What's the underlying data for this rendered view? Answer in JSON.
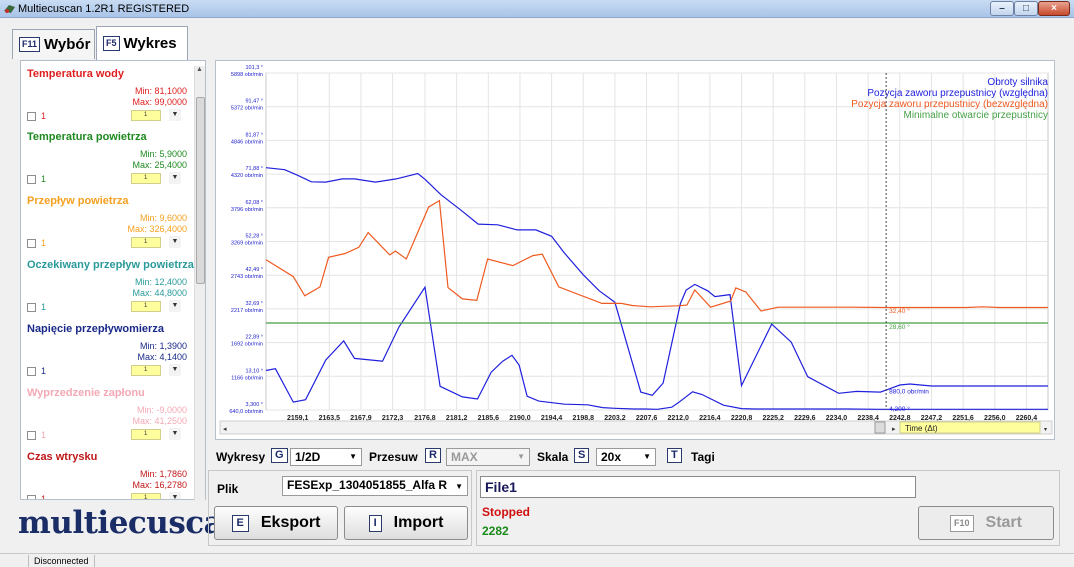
{
  "window": {
    "title": "Multiecuscan 1.2R1 REGISTERED",
    "min": "–",
    "max": "□",
    "close": "×"
  },
  "tabs": [
    {
      "key": "F11",
      "label": "Wybór"
    },
    {
      "key": "F5",
      "label": "Wykres"
    }
  ],
  "params": [
    {
      "name": "Temperatura wody",
      "min": "Min: 81,1000",
      "max": "Max: 99,0000",
      "num": "1",
      "sel": "1",
      "color": "#e02020"
    },
    {
      "name": "Temperatura powietrza",
      "min": "Min: 5,9000",
      "max": "Max: 25,4000",
      "num": "1",
      "sel": "1",
      "color": "#1f8a1f"
    },
    {
      "name": "Przepływ powietrza",
      "min": "Min: 9,6000",
      "max": "Max: 326,4000",
      "num": "1",
      "sel": "1",
      "color": "#f5a020"
    },
    {
      "name": "Oczekiwany przepływ powietrza",
      "min": "Min: 12,4000",
      "max": "Max: 44,8000",
      "num": "1",
      "sel": "1",
      "color": "#2a9a9a"
    },
    {
      "name": "Napięcie przepływomierza",
      "min": "Min: 1,3900",
      "max": "Max: 4,1400",
      "num": "1",
      "sel": "1",
      "color": "#1a2a8a"
    },
    {
      "name": "Wyprzedzenie zapłonu",
      "min": "Min: -9,0000",
      "max": "Max: 41,2500",
      "num": "1",
      "sel": "1",
      "color": "#f4a9b4"
    },
    {
      "name": "Czas wtrysku",
      "min": "Min: 1,7860",
      "max": "Max: 16,2780",
      "num": "1",
      "sel": "1",
      "color": "#c01818"
    }
  ],
  "logo": "multiecuscan",
  "chart_data": {
    "type": "line",
    "x_ticks": [
      "2159,1",
      "2163,5",
      "2167,9",
      "2172,3",
      "2176,8",
      "2181,2",
      "2185,6",
      "2190,0",
      "2194,4",
      "2198,8",
      "2203,2",
      "2207,6",
      "2212,0",
      "2216,4",
      "2220,8",
      "2225,2",
      "2229,6",
      "2234,0",
      "2238,4",
      "2242,8",
      "2247,2",
      "2251,6",
      "2256,0",
      "2260,4"
    ],
    "x_range": [
      2154.7,
      2263.4
    ],
    "y_ticks": [
      {
        "top": "101,3 °",
        "bottom": "5898 obr/min"
      },
      {
        "top": "91,47 °",
        "bottom": "5372 obr/min"
      },
      {
        "top": "81,87 °",
        "bottom": "4846 obr/min"
      },
      {
        "top": "71,88 °",
        "bottom": "4320 obr/min"
      },
      {
        "top": "62,08 °",
        "bottom": "3796 obr/min"
      },
      {
        "top": "52,28 °",
        "bottom": "3269 obr/min"
      },
      {
        "top": "42,49 °",
        "bottom": "2743 obr/min"
      },
      {
        "top": "32,69 °",
        "bottom": "2217 obr/min"
      },
      {
        "top": "22,89 °",
        "bottom": "1692 obr/min"
      },
      {
        "top": "13,10 °",
        "bottom": "1166 obr/min"
      },
      {
        "top": "3,300 °",
        "bottom": "640,0 obr/min"
      }
    ],
    "y_range_rpm": [
      640,
      5898
    ],
    "y_range_deg": [
      3.3,
      101.3
    ],
    "series": [
      {
        "name": "Obroty silnika",
        "color": "#2020dd",
        "x": [
          2154.7,
          2157.3,
          2159.1,
          2161.0,
          2163.0,
          2165.3,
          2167.0,
          2169.9,
          2172.8,
          2175.8,
          2176.8,
          2179.0,
          2182.0,
          2184.2,
          2186.9,
          2189.6,
          2192.2,
          2194.4,
          2196.1,
          2198.8,
          2201.0,
          2203.2,
          2206.8,
          2208.4,
          2209.9,
          2212.3,
          2213.1,
          2214.3,
          2216.1,
          2217.1,
          2219.2,
          2220.8,
          2225.0,
          2227.7,
          2230.0,
          2234.3,
          2236.8,
          2240.1,
          2242.8,
          2244.2,
          2247.2,
          2254.6,
          2259.1,
          2263.4
        ],
        "y": [
          4420,
          4390,
          4302,
          4200,
          4196,
          4245,
          4245,
          4196,
          4245,
          4330,
          4240,
          4000,
          3740,
          3540,
          3530,
          3450,
          3450,
          3350,
          3100,
          2750,
          2502,
          2320,
          920,
          870,
          1060,
          2300,
          2510,
          2600,
          2500,
          2410,
          2440,
          1020,
          1980,
          1700,
          1160,
          900,
          930,
          920,
          1030,
          1046,
          1015,
          1015,
          1015,
          1015
        ]
      },
      {
        "name": "Pozycja zaworu przepustnicy (względna)",
        "color": "#2020dd",
        "x": [
          2154.7,
          2156.0,
          2158.5,
          2160.2,
          2163.0,
          2165.5,
          2167.0,
          2170.9,
          2173.2,
          2176.8,
          2177.4,
          2178.9,
          2182.0,
          2184.1,
          2186.0,
          2187.6,
          2188.9,
          2189.9,
          2191.0,
          2192.6,
          2196.2,
          2199.4,
          2201.5,
          2203.2,
          2205.9,
          2207.4,
          2209.1,
          2211.1,
          2212.0,
          2214.0,
          2215.3,
          2218.3,
          2220.8,
          2222.6,
          2224.5,
          2227.7,
          2232.5,
          2235.6,
          2239.9,
          2242.8,
          2246.1,
          2251.0,
          2256.0,
          2260.2,
          2263.4
        ],
        "y": [
          14.8,
          15.3,
          5.6,
          6.3,
          17.8,
          23.4,
          18.3,
          17.5,
          27.5,
          39.0,
          30.7,
          10.2,
          7.1,
          6.5,
          14.3,
          17.5,
          19.2,
          16.3,
          7.3,
          5.9,
          5.0,
          4.8,
          4.0,
          3.8,
          3.6,
          3.6,
          3.5,
          4.1,
          5.4,
          8.6,
          7.8,
          4.7,
          3.7,
          3.6,
          3.6,
          3.6,
          3.6,
          3.6,
          3.5,
          3.5,
          3.5,
          3.5,
          3.5,
          3.5,
          3.5
        ]
      },
      {
        "name": "Pozycja zaworu przepustnicy (bezwzględna)",
        "color": "#ef5a20",
        "x": [
          2154.7,
          2158.5,
          2160.1,
          2162.2,
          2163.4,
          2165.7,
          2167.6,
          2168.9,
          2171.9,
          2172.7,
          2174.2,
          2177.3,
          2178.8,
          2180.0,
          2182.0,
          2184.0,
          2185.5,
          2189.0,
          2191.8,
          2193.1,
          2195.4,
          2201.4,
          2204.1,
          2205.6,
          2208.1,
          2211.9,
          2213.2,
          2214.3,
          2216.5,
          2219.3,
          2220.0,
          2221.4,
          2223.5,
          2225.9,
          2229.3,
          2233.1,
          2236.0,
          2240.8,
          2242.3,
          2244.0,
          2247.2,
          2249.9,
          2252.0,
          2254.3,
          2256.6,
          2260.4,
          2263.4
        ],
        "y": [
          47.0,
          42.1,
          36.5,
          39.1,
          47.7,
          48.8,
          50.6,
          54.9,
          48.4,
          49.5,
          47.2,
          62.3,
          64.2,
          38.9,
          35.6,
          35.2,
          47.2,
          45.3,
          48.2,
          48.6,
          39.1,
          34.3,
          34.3,
          33.7,
          33.3,
          33.6,
          33.8,
          38.2,
          33.2,
          35.0,
          38.8,
          37.6,
          32.1,
          33.2,
          33.2,
          33.2,
          33.2,
          33.1,
          33.1,
          33.1,
          33.1,
          33.1,
          33.1,
          33.3,
          33.1,
          33.1,
          33.1
        ]
      },
      {
        "name": "Minimalne otwarcie przepustnicy",
        "color": "#46a046",
        "x": [
          2154.7,
          2263.4
        ],
        "y": [
          28.6,
          28.6
        ]
      }
    ],
    "cursor": {
      "x": 2240.9,
      "labels": [
        "32,40 °",
        "28,60 °",
        "880,0 obr/min",
        "4,200 °"
      ]
    },
    "x_axis_label": "Time (Δt)"
  },
  "controls": {
    "wykresy_label": "Wykresy",
    "wykresy_key": "G",
    "wykresy_value": "1/2D",
    "przesuw_label": "Przesuw",
    "przesuw_key": "R",
    "przesuw_value": "MAX",
    "skala_label": "Skala",
    "skala_key": "S",
    "skala_value": "20x",
    "tagi_key": "T",
    "tagi_label": "Tagi",
    "plik_label": "Plik",
    "plik_value": "FESExp_1304051855_Alfa R",
    "file_name": "File1",
    "status": "Stopped",
    "counter": "2282",
    "eksport_key": "E",
    "eksport_label": "Eksport",
    "import_key": "I",
    "import_label": "Import",
    "start_key": "F10",
    "start_label": "Start"
  },
  "statusbar": {
    "connection": "Disconnected"
  }
}
